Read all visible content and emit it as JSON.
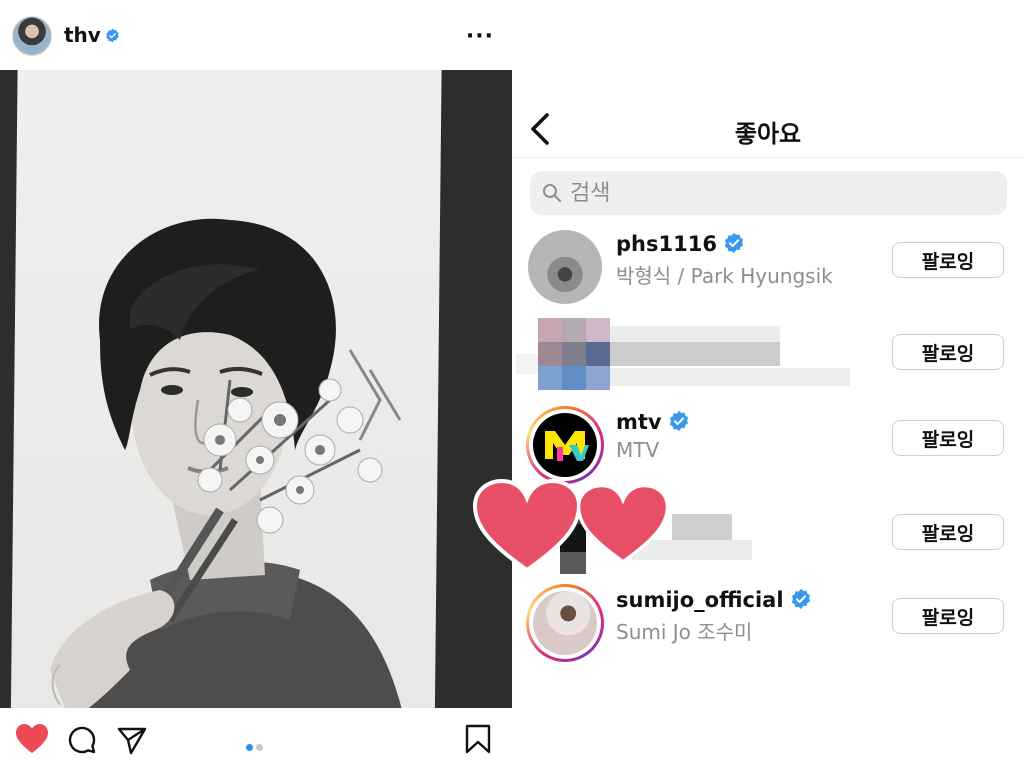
{
  "post": {
    "username": "thv",
    "more_label": "···",
    "carousel_pages": 2,
    "carousel_active": 1
  },
  "likes": {
    "title": "좋아요",
    "search_placeholder": "검색",
    "rows": [
      {
        "username": "phs1116",
        "subtitle": "박형식 / Park Hyungsik",
        "verified": true,
        "button": "팔로잉"
      },
      {
        "username": "",
        "subtitle": "",
        "verified": false,
        "button": "팔로잉",
        "censored": true
      },
      {
        "username": "mtv",
        "subtitle": "MTV",
        "verified": true,
        "button": "팔로잉"
      },
      {
        "username": "",
        "subtitle": "",
        "verified": false,
        "button": "팔로잉",
        "censored": true
      },
      {
        "username": "sumijo_official",
        "subtitle": "Sumi Jo 조수미",
        "verified": true,
        "button": "팔로잉"
      }
    ]
  },
  "colors": {
    "verified_blue": "#3897f0",
    "like_red": "#ed4956",
    "sticker_pink": "#e85068",
    "dot_active": "#2b8fef"
  },
  "icons": [
    "more-icon",
    "heart-icon",
    "comment-icon",
    "share-icon",
    "bookmark-icon",
    "back-icon",
    "search-icon",
    "verified-badge-icon"
  ]
}
